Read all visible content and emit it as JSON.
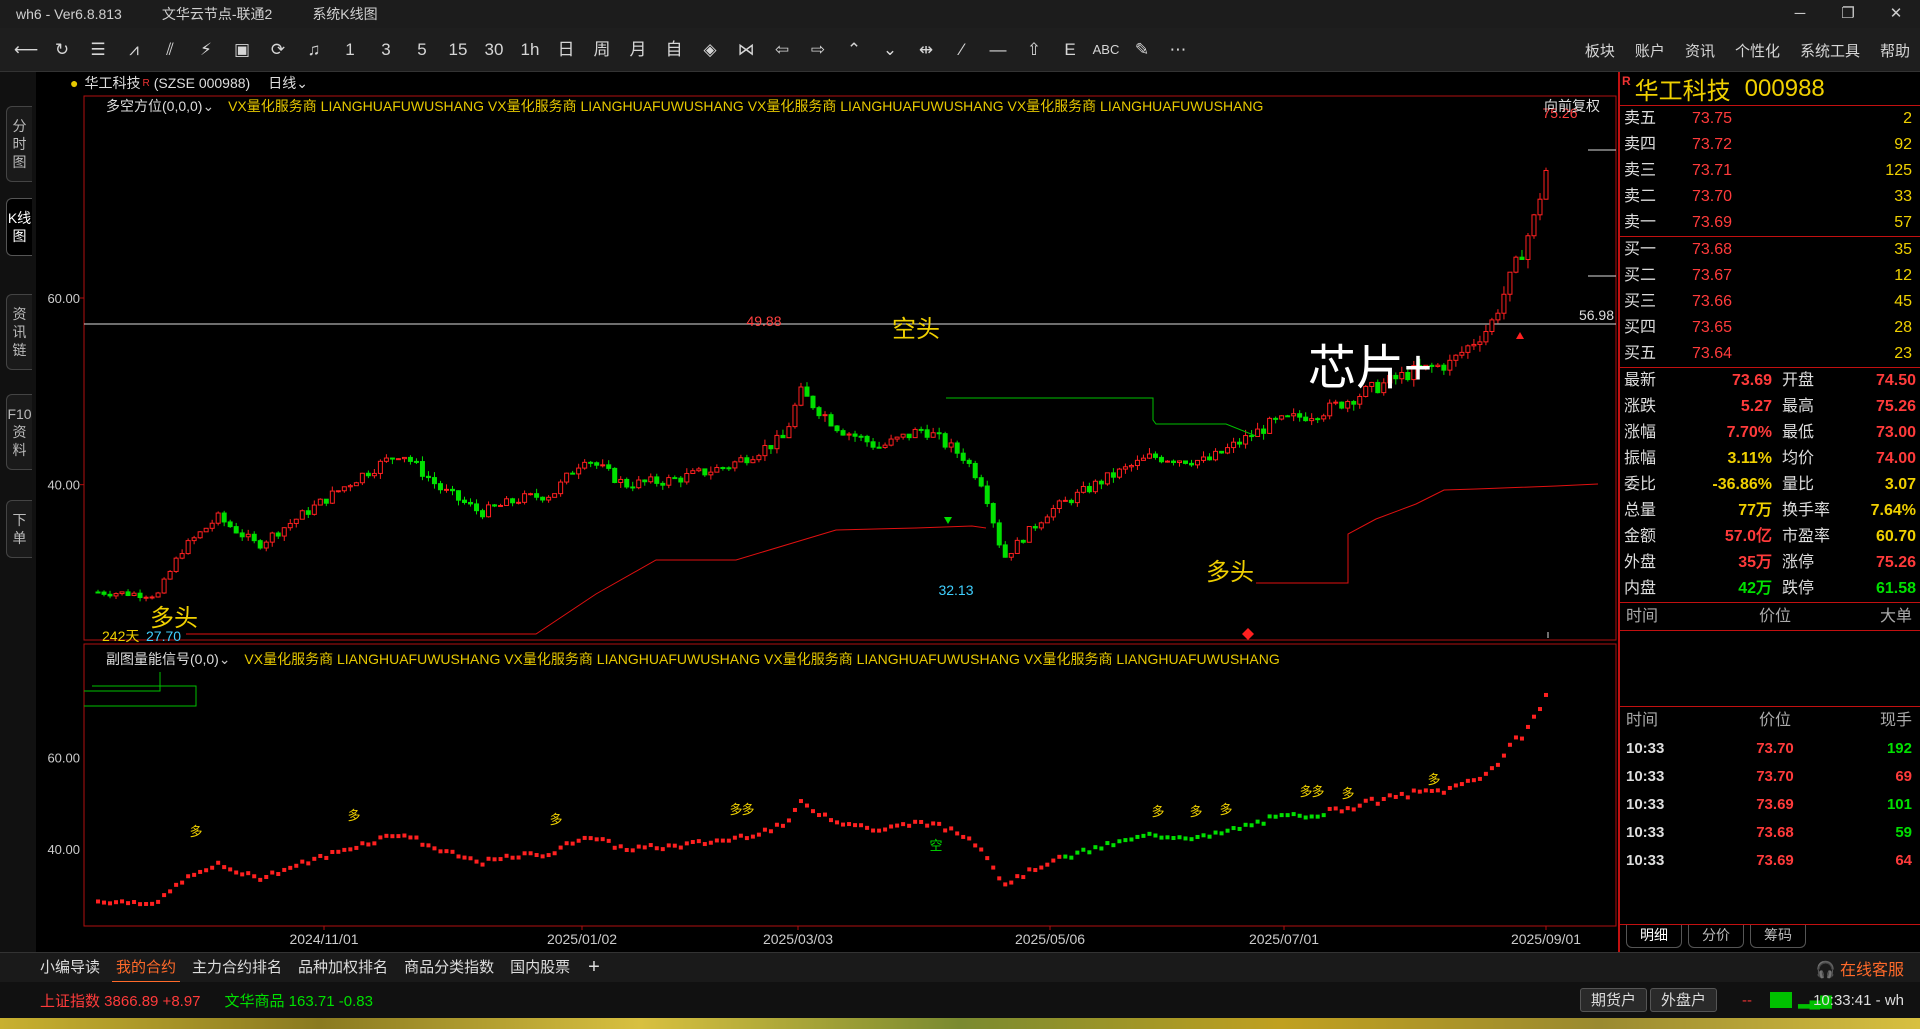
{
  "titlebar": {
    "app": "wh6 - Ver6.8.813",
    "server": "文华云节点-联通2",
    "view": "系统K线图",
    "min": "─",
    "max": "❐",
    "close": "✕"
  },
  "toolbar": {
    "icons": [
      "back-icon",
      "refresh-icon",
      "list-icon",
      "line-chart-icon",
      "candlestick-icon",
      "bar-icon",
      "table-icon",
      "sync-icon",
      "bell-icon"
    ],
    "periods": [
      "1",
      "3",
      "5",
      "15",
      "30",
      "1h",
      "日",
      "周",
      "月",
      "自"
    ],
    "menu": [
      "板块",
      "账户",
      "资讯",
      "个性化",
      "系统工具",
      "帮助"
    ]
  },
  "vtabs": [
    "分时图",
    "K线图",
    "资讯链",
    "F10资料",
    "下单"
  ],
  "chart_header": {
    "stock": "华工科技",
    "sup": "R",
    "code": "(SZSE 000988)",
    "period": "日线"
  },
  "main_indicator": {
    "name": "多空方位(0,0,0)",
    "ad": "VX量化服务商  LIANGHUAFUWUSHANG  VX量化服务商  LIANGHUAFUWUSHANG  VX量化服务商  LIANGHUAFUWUSHANG  VX量化服务商  LIANGHUAFUWUSHANG",
    "fq": "向前复权"
  },
  "sub_indicator": {
    "name": "副图量能信号(0,0)",
    "ad": "VX量化服务商  LIANGHUAFUWUSHANG  VX量化服务商  LIANGHUAFUWUSHANG  VX量化服务商  LIANGHUAFUWUSHANG  VX量化服务商  LIANGHUAFUWUSHANG"
  },
  "annotations": {
    "kongtou": "空头",
    "duotou": "多头",
    "duotou2": "多头",
    "chip": "芯片+",
    "high_label": "75.26",
    "peak_label": "49.88",
    "low_label": "32.13",
    "start_low": "27.70",
    "days": "242天",
    "line_label": "56.98"
  },
  "axis": {
    "main_ticks": [
      "60.00",
      "40.00"
    ],
    "sub_ticks": [
      "60.00",
      "40.00"
    ],
    "dates": [
      "2024/11/01",
      "2025/01/02",
      "2025/03/03",
      "2025/05/06",
      "2025/07/01",
      "2025/09/01"
    ]
  },
  "sub_labels": {
    "duo": "多",
    "kong": "空"
  },
  "quote": {
    "r": "R",
    "name": "华工科技",
    "code": "000988",
    "asks": [
      {
        "label": "卖五",
        "price": "73.75",
        "vol": "2"
      },
      {
        "label": "卖四",
        "price": "73.72",
        "vol": "92"
      },
      {
        "label": "卖三",
        "price": "73.71",
        "vol": "125"
      },
      {
        "label": "卖二",
        "price": "73.70",
        "vol": "33"
      },
      {
        "label": "卖一",
        "price": "73.69",
        "vol": "57"
      }
    ],
    "bids": [
      {
        "label": "买一",
        "price": "73.68",
        "vol": "35"
      },
      {
        "label": "买二",
        "price": "73.67",
        "vol": "12"
      },
      {
        "label": "买三",
        "price": "73.66",
        "vol": "45"
      },
      {
        "label": "买四",
        "price": "73.65",
        "vol": "28"
      },
      {
        "label": "买五",
        "price": "73.64",
        "vol": "23"
      }
    ],
    "stats": [
      {
        "k": "最新",
        "v": "73.69",
        "c": "red",
        "k2": "开盘",
        "v2": "74.50",
        "c2": "red"
      },
      {
        "k": "涨跌",
        "v": "5.27",
        "c": "red",
        "k2": "最高",
        "v2": "75.26",
        "c2": "red"
      },
      {
        "k": "涨幅",
        "v": "7.70%",
        "c": "red",
        "k2": "最低",
        "v2": "73.00",
        "c2": "red"
      },
      {
        "k": "振幅",
        "v": "3.11%",
        "c": "yellow",
        "k2": "均价",
        "v2": "74.00",
        "c2": "red"
      },
      {
        "k": "委比",
        "v": "-36.86%",
        "c": "yellow",
        "k2": "量比",
        "v2": "3.07",
        "c2": "yellow"
      },
      {
        "k": "总量",
        "v": "77万",
        "c": "yellow",
        "k2": "换手率",
        "v2": "7.64%",
        "c2": "yellow"
      },
      {
        "k": "金额",
        "v": "57.0亿",
        "c": "red",
        "k2": "市盈率",
        "v2": "60.70",
        "c2": "yellow"
      },
      {
        "k": "外盘",
        "v": "35万",
        "c": "red",
        "k2": "涨停",
        "v2": "75.26",
        "c2": "red"
      },
      {
        "k": "内盘",
        "v": "42万",
        "c": "green",
        "k2": "跌停",
        "v2": "61.58",
        "c2": "green"
      }
    ],
    "big_head": [
      "时间",
      "价位",
      "大单"
    ],
    "tick_head": [
      "时间",
      "价位",
      "现手"
    ],
    "ticks": [
      {
        "t": "10:33",
        "p": "73.70",
        "v": "192",
        "c": "green"
      },
      {
        "t": "10:33",
        "p": "73.70",
        "v": "69",
        "c": "red"
      },
      {
        "t": "10:33",
        "p": "73.69",
        "v": "101",
        "c": "green"
      },
      {
        "t": "10:33",
        "p": "73.68",
        "v": "59",
        "c": "green"
      },
      {
        "t": "10:33",
        "p": "73.69",
        "v": "64",
        "c": "red"
      }
    ],
    "tabs": [
      "明细",
      "分价",
      "筹码"
    ]
  },
  "bottom_tabs": [
    "小编导读",
    "我的合约",
    "主力合约排名",
    "品种加权排名",
    "商品分类指数",
    "国内股票"
  ],
  "service": "在线客服",
  "status": {
    "index1": "上证指数  3866.89  +8.97",
    "index2": "文华商品  163.71  -0.83",
    "btn1": "期货户",
    "btn2": "外盘户",
    "clock": "10:33:41 - wh"
  },
  "chart_data": {
    "type": "candlestick",
    "title": "华工科技 000988 日线",
    "x_range": [
      "2024/09/10",
      "2025/09/08"
    ],
    "ylim": [
      24,
      78
    ],
    "close_path": [
      [
        "2024/09/10",
        28.5
      ],
      [
        "2024/09/25",
        28.2
      ],
      [
        "2024/10/01",
        33.0
      ],
      [
        "2024/10/10",
        36.5
      ],
      [
        "2024/10/20",
        33.5
      ],
      [
        "2024/11/01",
        37.0
      ],
      [
        "2024/11/15",
        41.0
      ],
      [
        "2024/11/25",
        43.5
      ],
      [
        "2024/12/05",
        39.5
      ],
      [
        "2024/12/15",
        37.0
      ],
      [
        "2024/12/25",
        38.5
      ],
      [
        "2025/01/02",
        39.0
      ],
      [
        "2025/01/10",
        43.0
      ],
      [
        "2025/01/20",
        40.0
      ],
      [
        "2025/02/01",
        40.5
      ],
      [
        "2025/02/15",
        42.0
      ],
      [
        "2025/03/01",
        45.0
      ],
      [
        "2025/03/05",
        49.88
      ],
      [
        "2025/03/15",
        46.0
      ],
      [
        "2025/03/25",
        44.0
      ],
      [
        "2025/04/05",
        46.0
      ],
      [
        "2025/04/15",
        43.0
      ],
      [
        "2025/04/20",
        40.0
      ],
      [
        "2025/04/25",
        32.13
      ],
      [
        "2025/05/06",
        37.0
      ],
      [
        "2025/05/20",
        40.5
      ],
      [
        "2025/06/01",
        43.0
      ],
      [
        "2025/06/15",
        42.5
      ],
      [
        "2025/06/25",
        45.0
      ],
      [
        "2025/07/01",
        46.5
      ],
      [
        "2025/07/15",
        48.0
      ],
      [
        "2025/07/25",
        50.0
      ],
      [
        "2025/08/05",
        52.0
      ],
      [
        "2025/08/15",
        53.0
      ],
      [
        "2025/08/25",
        57.0
      ],
      [
        "2025/09/01",
        64.0
      ],
      [
        "2025/09/05",
        68.4
      ],
      [
        "2025/09/08",
        73.69
      ]
    ],
    "resistance_line": 56.98,
    "high": 75.26
  }
}
